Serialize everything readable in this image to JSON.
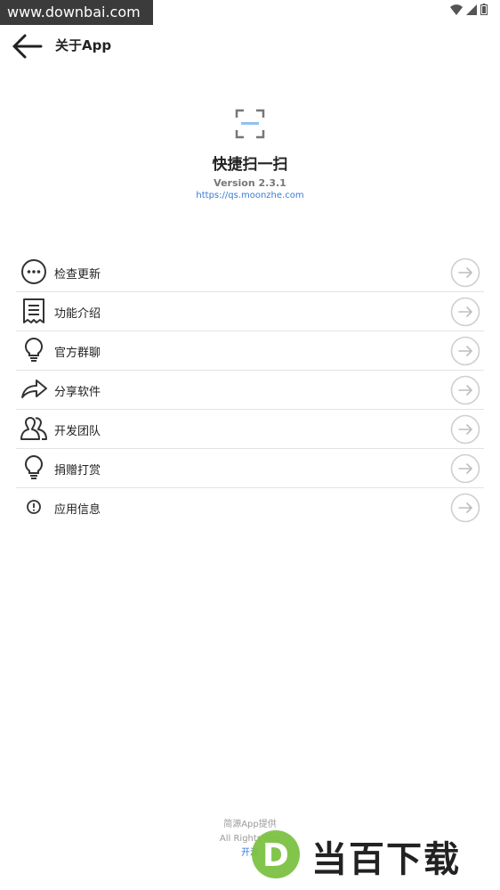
{
  "watermark_top": "www.downbai.com",
  "appbar": {
    "title": "关于App"
  },
  "app": {
    "name": "快捷扫一扫",
    "version": "Version 2.3.1",
    "url": "https://qs.moonzhe.com"
  },
  "menu": [
    {
      "label": "检查更新",
      "icon": "more-dots-icon"
    },
    {
      "label": "功能介绍",
      "icon": "document-icon"
    },
    {
      "label": "官方群聊",
      "icon": "lightbulb-icon"
    },
    {
      "label": "分享软件",
      "icon": "share-arrow-icon"
    },
    {
      "label": "开发团队",
      "icon": "team-icon"
    },
    {
      "label": "捐赠打赏",
      "icon": "lightbulb-icon"
    },
    {
      "label": "应用信息",
      "icon": "info-icon"
    }
  ],
  "footer": {
    "line1": "简源App提供",
    "line2": "All Rights Res",
    "line3": "开源"
  },
  "watermark_bottom": {
    "letter": "D",
    "text": "当百下载"
  },
  "colors": {
    "accent": "#3a7bd5",
    "logo_bar": "#8fc1f0",
    "watermark_green": "#7cc242"
  }
}
